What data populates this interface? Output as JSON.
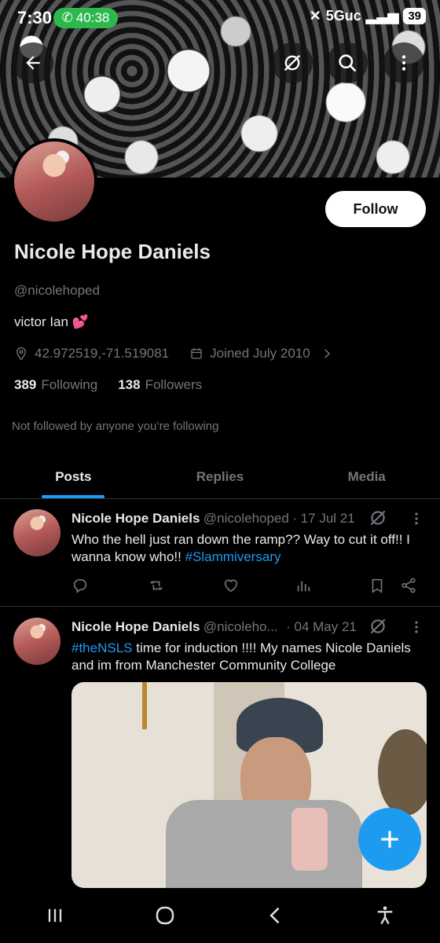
{
  "status_bar": {
    "time": "7:30",
    "call_timer": "40:38",
    "network": "5Guc",
    "battery": "39"
  },
  "profile": {
    "display_name": "Nicole Hope Daniels",
    "handle": "@nicolehoped",
    "bio": "victor Ian 💕",
    "location": "42.972519,-71.519081",
    "joined": "Joined July 2010",
    "following_count": "389",
    "following_label": "Following",
    "followers_count": "138",
    "followers_label": "Followers",
    "not_followed": "Not followed by anyone you’re following",
    "follow_button": "Follow"
  },
  "tabs": [
    {
      "label": "Posts",
      "active": true
    },
    {
      "label": "Replies",
      "active": false
    },
    {
      "label": "Media",
      "active": false
    }
  ],
  "posts": [
    {
      "name": "Nicole Hope Daniels",
      "handle": "@nicolehoped",
      "date": "· 17 Jul 21",
      "text": "Who the hell just ran down the ramp?? Way to cut it off!! I wanna know who!! ",
      "hashtag": "#Slammiversary"
    },
    {
      "name": "Nicole Hope Daniels",
      "handle": "@nicoleho...",
      "date": "· 04 May 21",
      "hashtag": "#theNSLS",
      "text": " time for induction !!!! My names Nicole Daniels and im from Manchester Community College"
    }
  ],
  "colors": {
    "accent": "#1d9bf0",
    "background": "#000000",
    "secondary_text": "#71767b",
    "call_pill": "#2db84d"
  }
}
